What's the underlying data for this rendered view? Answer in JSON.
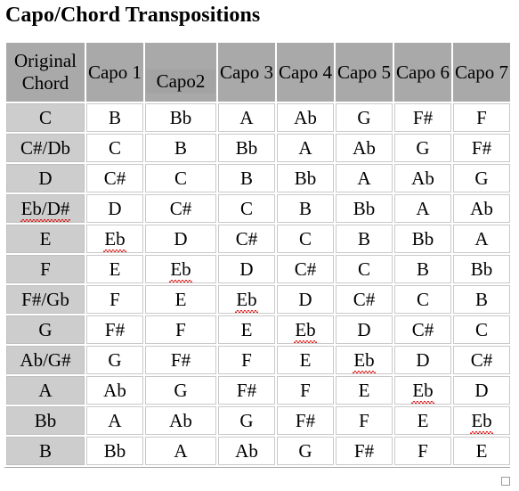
{
  "document": {
    "title": "Capo/Chord Transpositions"
  },
  "table": {
    "name": "capo-chord-transposition-table",
    "headers": [
      "Original Chord",
      "Capo 1",
      "Capo2",
      "Capo 3",
      "Capo 4",
      "Capo 5",
      "Capo 6",
      "Capo 7"
    ],
    "selected_header_index": 2,
    "selected_header_text": "Capo2",
    "colors": {
      "header_background": "#a9a9a9",
      "selected_header_background": "#cbcbcb",
      "selection_band": "#a3a3a3",
      "row_header_background": "#cdcdcd",
      "cell_background": "#ffffff",
      "cell_border": "#c9c9c9",
      "text": "#000000",
      "spellcheck_underline": "#e01b1b"
    },
    "rows": [
      {
        "chord": "C",
        "transpositions": [
          "B",
          "Bb",
          "A",
          "Ab",
          "G",
          "F#",
          "F"
        ]
      },
      {
        "chord": "C#/Db",
        "transpositions": [
          "C",
          "B",
          "Bb",
          "A",
          "Ab",
          "G",
          "F#"
        ]
      },
      {
        "chord": "D",
        "transpositions": [
          "C#",
          "C",
          "B",
          "Bb",
          "A",
          "Ab",
          "G"
        ]
      },
      {
        "chord": "Eb/D#",
        "transpositions": [
          "D",
          "C#",
          "C",
          "B",
          "Bb",
          "A",
          "Ab"
        ]
      },
      {
        "chord": "E",
        "transpositions": [
          "Eb",
          "D",
          "C#",
          "C",
          "B",
          "Bb",
          "A"
        ]
      },
      {
        "chord": "F",
        "transpositions": [
          "E",
          "Eb",
          "D",
          "C#",
          "C",
          "B",
          "Bb"
        ]
      },
      {
        "chord": "F#/Gb",
        "transpositions": [
          "F",
          "E",
          "Eb",
          "D",
          "C#",
          "C",
          "B"
        ]
      },
      {
        "chord": "G",
        "transpositions": [
          "F#",
          "F",
          "E",
          "Eb",
          "D",
          "C#",
          "C"
        ]
      },
      {
        "chord": "Ab/G#",
        "transpositions": [
          "G",
          "F#",
          "F",
          "E",
          "Eb",
          "D",
          "C#"
        ]
      },
      {
        "chord": "A",
        "transpositions": [
          "Ab",
          "G",
          "F#",
          "F",
          "E",
          "Eb",
          "D"
        ]
      },
      {
        "chord": "Bb",
        "transpositions": [
          "A",
          "Ab",
          "G",
          "F#",
          "F",
          "E",
          "Eb"
        ]
      },
      {
        "chord": "B",
        "transpositions": [
          "Bb",
          "A",
          "Ab",
          "G",
          "F#",
          "F",
          "E"
        ]
      }
    ],
    "spellchecked_terms": [
      "Eb",
      "Eb/D#"
    ]
  }
}
